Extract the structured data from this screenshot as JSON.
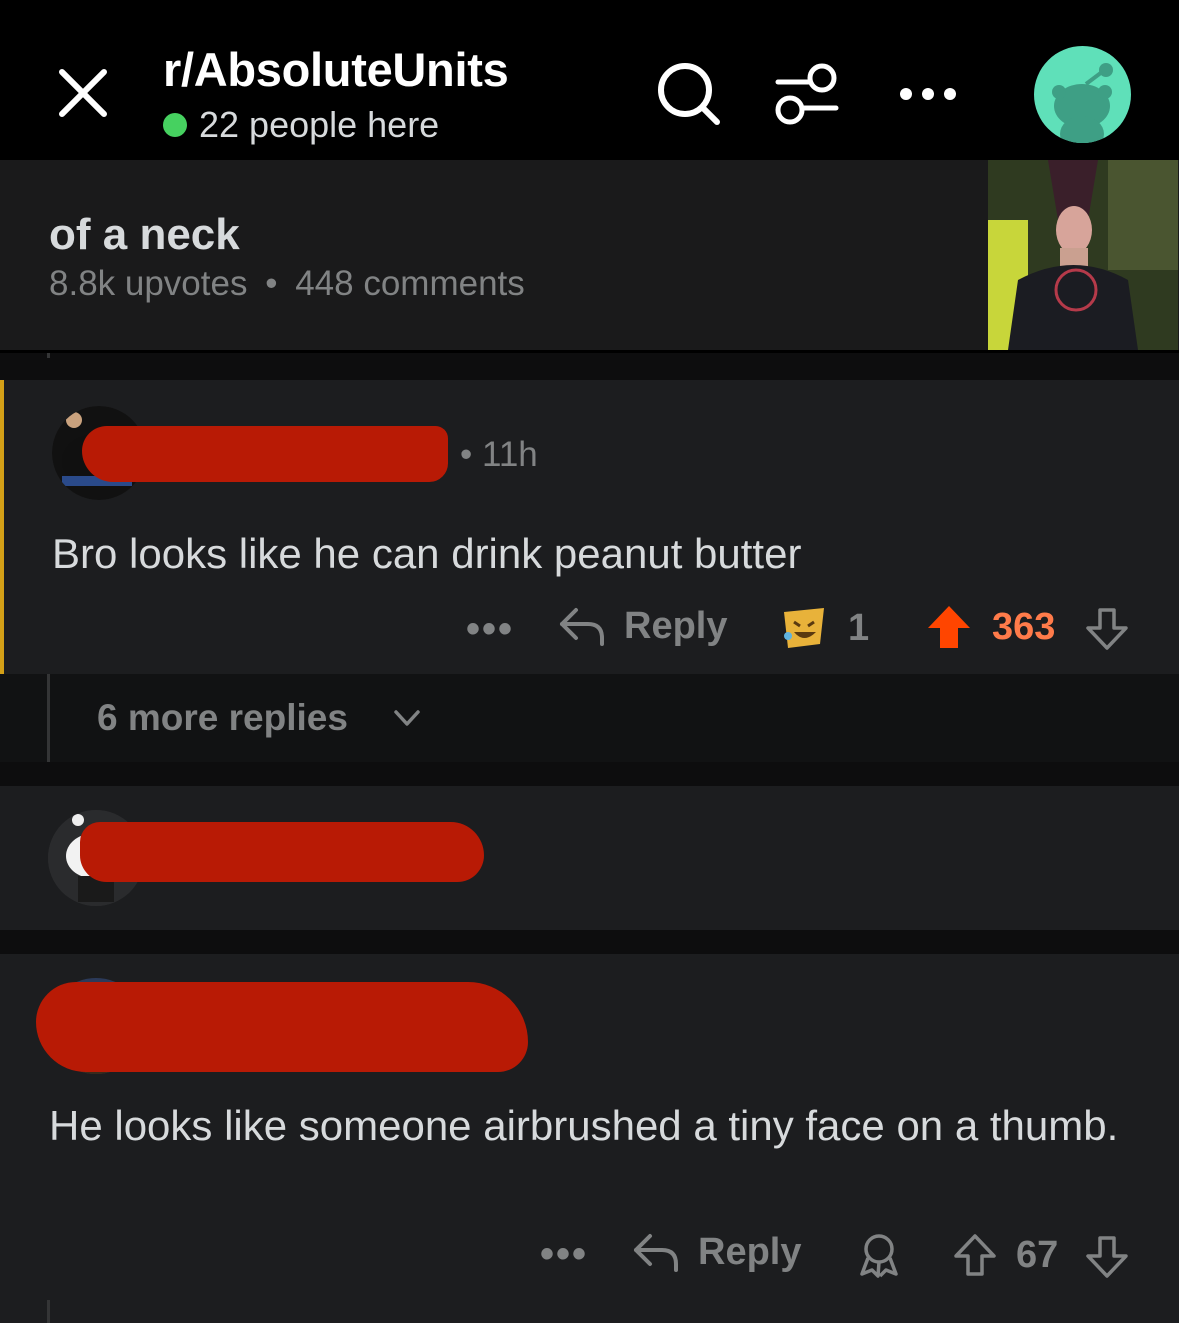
{
  "header": {
    "subreddit": "r/AbsoluteUnits",
    "online_count": "22 people here",
    "icons": [
      "close-icon",
      "search-icon",
      "filter-icon",
      "more-icon",
      "avatar"
    ]
  },
  "post": {
    "title": "of a neck",
    "upvotes": "8.8k upvotes",
    "separator": "•",
    "comments": "448 comments"
  },
  "comments": [
    {
      "time": "• 11h",
      "text": "Bro looks like he can drink peanut butter",
      "more": "•••",
      "reply_label": "Reply",
      "award_count": "1",
      "score": "363",
      "upvoted": true
    },
    {
      "more_replies": "6 more replies"
    },
    {
      "collapsed": true
    },
    {
      "text": "He looks like someone airbrushed a tiny face on a thumb.",
      "more": "•••",
      "reply_label": "Reply",
      "score": "67",
      "upvoted": false
    }
  ],
  "colors": {
    "upvote": "#ff4500",
    "score_active": "#ff7b4a",
    "online": "#46d160",
    "highlight": "#d4a017"
  }
}
